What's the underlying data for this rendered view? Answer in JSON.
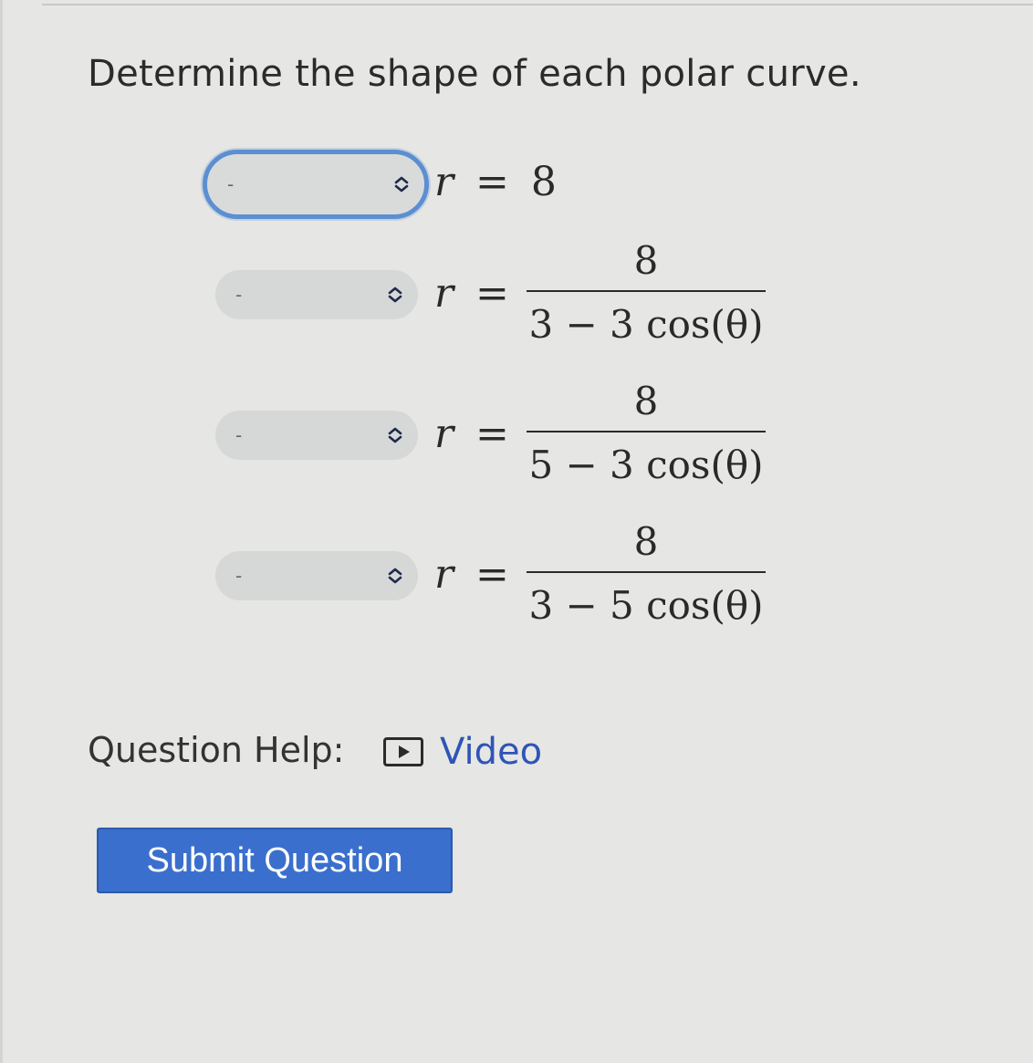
{
  "question": {
    "text": "Determine the shape of each polar curve."
  },
  "rows": [
    {
      "select_value": "-",
      "lhs_var": "r",
      "eq": "=",
      "rhs": "8"
    },
    {
      "select_value": "-",
      "lhs_var": "r",
      "eq": "=",
      "numerator": "8",
      "denominator": "3 − 3 cos(θ)"
    },
    {
      "select_value": "-",
      "lhs_var": "r",
      "eq": "=",
      "numerator": "8",
      "denominator": "5 − 3 cos(θ)"
    },
    {
      "select_value": "-",
      "lhs_var": "r",
      "eq": "=",
      "numerator": "8",
      "denominator": "3 − 5 cos(θ)"
    }
  ],
  "help": {
    "label": "Question Help:",
    "video_icon": "video-play-icon",
    "video_label": "Video"
  },
  "submit_label": "Submit Question",
  "colors": {
    "focus_ring": "#5b8fd1",
    "link": "#2f54b8",
    "button": "#3a6fcd"
  }
}
